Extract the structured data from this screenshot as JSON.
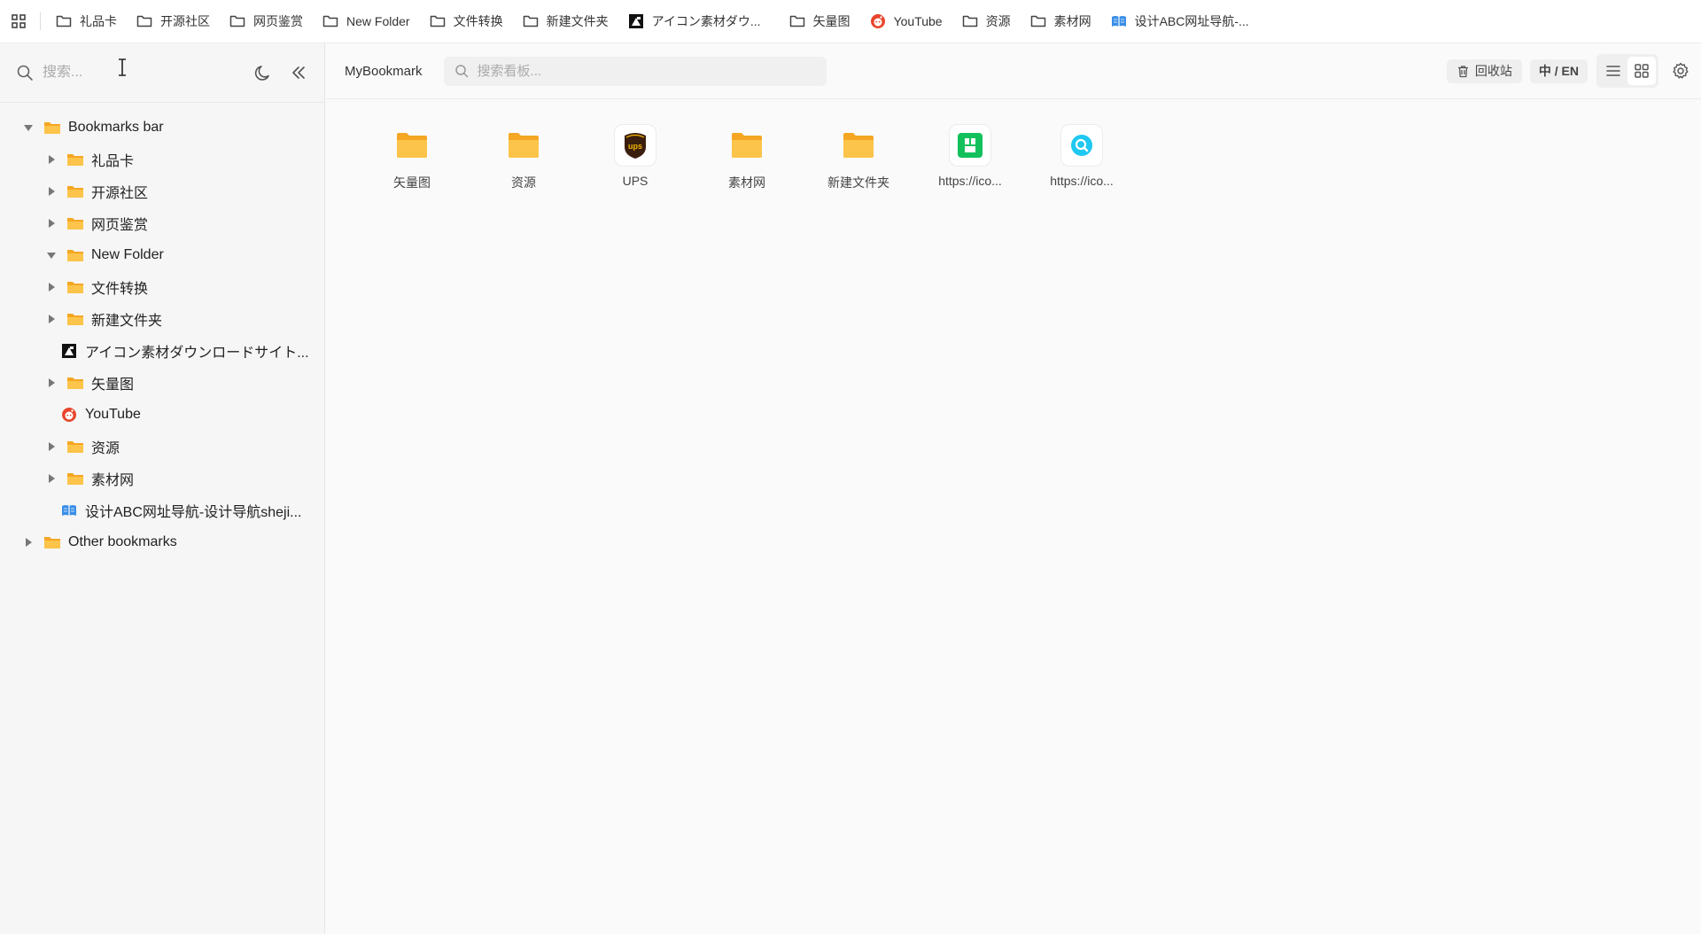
{
  "bookmarks_bar": {
    "items": [
      {
        "label": "礼品卡",
        "icon": "folder-icon"
      },
      {
        "label": "开源社区",
        "icon": "folder-icon"
      },
      {
        "label": "网页鉴赏",
        "icon": "folder-icon"
      },
      {
        "label": "New Folder",
        "icon": "folder-icon"
      },
      {
        "label": "文件转换",
        "icon": "folder-icon"
      },
      {
        "label": "新建文件夹",
        "icon": "folder-icon"
      },
      {
        "label": "アイコン素材ダウ...",
        "icon": "icon-site-favicon"
      },
      {
        "label": "矢量图",
        "icon": "folder-icon"
      },
      {
        "label": "YouTube",
        "icon": "youtube-favicon"
      },
      {
        "label": "资源",
        "icon": "folder-icon"
      },
      {
        "label": "素材网",
        "icon": "folder-icon"
      },
      {
        "label": "设计ABC网址导航-...",
        "icon": "book-favicon"
      }
    ]
  },
  "sidebar": {
    "search_placeholder": "搜索...",
    "tree": {
      "bookmarks_bar": "Bookmarks bar",
      "children": [
        {
          "label": "礼品卡",
          "type": "folder",
          "expanded": false
        },
        {
          "label": "开源社区",
          "type": "folder",
          "expanded": false
        },
        {
          "label": "网页鉴赏",
          "type": "folder",
          "expanded": false
        },
        {
          "label": "New Folder",
          "type": "folder",
          "expanded": true
        },
        {
          "label": "文件转换",
          "type": "folder",
          "expanded": false
        },
        {
          "label": "新建文件夹",
          "type": "folder",
          "expanded": false
        },
        {
          "label": "アイコン素材ダウンロードサイト...",
          "type": "link"
        },
        {
          "label": "矢量图",
          "type": "folder",
          "expanded": false
        },
        {
          "label": "YouTube",
          "type": "link"
        },
        {
          "label": "资源",
          "type": "folder",
          "expanded": false
        },
        {
          "label": "素材网",
          "type": "folder",
          "expanded": false
        },
        {
          "label": "设计ABC网址导航-设计导航sheji...",
          "type": "link"
        }
      ],
      "other_bookmarks": "Other bookmarks"
    }
  },
  "header": {
    "brand": "MyBookmark",
    "search_placeholder": "搜索看板...",
    "trash_label": "回收站",
    "lang_label": "中 / EN"
  },
  "grid": {
    "items": [
      {
        "label": "矢量图",
        "type": "folder"
      },
      {
        "label": "资源",
        "type": "folder"
      },
      {
        "label": "UPS",
        "type": "link"
      },
      {
        "label": "素材网",
        "type": "folder"
      },
      {
        "label": "新建文件夹",
        "type": "folder"
      },
      {
        "label": "https://ico...",
        "type": "link"
      },
      {
        "label": "https://ico...",
        "type": "link"
      }
    ]
  },
  "colors": {
    "folder": "#f5a623",
    "folder_light": "#fcc44a",
    "ups_brown": "#3b1f0e",
    "ups_gold": "#f5b700",
    "green_icon": "#12c15c",
    "cyan_icon": "#1ec8f0",
    "youtube_red": "#e8452c"
  }
}
